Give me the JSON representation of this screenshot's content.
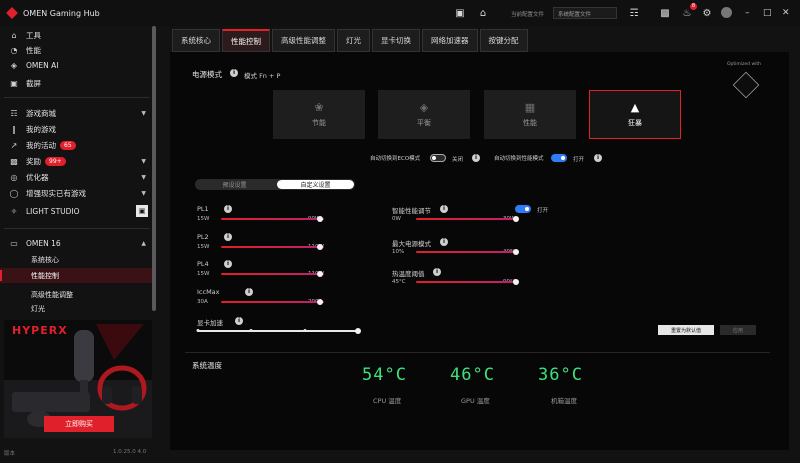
{
  "app": {
    "title": "OMEN Gaming Hub"
  },
  "titlebar": {
    "profile_label": "当前配置文件",
    "profile_value": "系统配置文件",
    "notification_count": "8",
    "icons": [
      "home-icon",
      "controller-icon",
      "gift-icon",
      "bell-icon",
      "gear-icon",
      "avatar"
    ]
  },
  "sidebar": {
    "top": [
      {
        "label": "工具",
        "icon": "home-icon"
      },
      {
        "label": "性能",
        "icon": "gauge-icon"
      },
      {
        "label": "OMEN AI",
        "icon": "diamond-icon"
      },
      {
        "label": "截屏",
        "icon": "camera-icon"
      }
    ],
    "middle": [
      {
        "label": "游戏商城",
        "icon": "gamepad-icon"
      },
      {
        "label": "我的游戏",
        "icon": "library-icon"
      },
      {
        "label": "我的活动",
        "icon": "chart-icon",
        "badge": "65"
      },
      {
        "label": "奖励",
        "icon": "gift-icon",
        "badge": "99+"
      },
      {
        "label": "优化器",
        "icon": "rocket-icon"
      },
      {
        "label": "增强现实已有游戏",
        "icon": "globe-icon"
      },
      {
        "label": "LIGHT STUDIO",
        "icon": "light-icon"
      }
    ],
    "device": {
      "label": "OMEN 16",
      "icon": "laptop-icon"
    },
    "device_items": [
      {
        "label": "系统核心"
      },
      {
        "label": "性能控制",
        "active": true
      },
      {
        "label": "高级性能调整"
      },
      {
        "label": "灯光"
      }
    ],
    "ad": {
      "brand": "HYPERX",
      "button": "立即购买"
    },
    "footer_left": "版本",
    "footer_right": "1.0.25.0 4.0"
  },
  "tabs": [
    "系统核心",
    "性能控制",
    "高级性能调整",
    "灯光",
    "显卡切换",
    "网络加速器",
    "按键分配"
  ],
  "power": {
    "title": "电源模式",
    "subtitle": "模式 Fn + P",
    "badge_text": "Optimized with",
    "modes": [
      {
        "label": "节能",
        "icon": "leaf-icon"
      },
      {
        "label": "平衡",
        "icon": "diamond-icon"
      },
      {
        "label": "性能",
        "icon": "bars-icon"
      },
      {
        "label": "狂暴",
        "icon": "flame-icon",
        "active": true
      }
    ]
  },
  "toggles": {
    "a_label": "自动切换到ECO模式",
    "a_state": "关闭",
    "b_label": "自动切换到性能模式",
    "b_state": "打开"
  },
  "segment": {
    "left": "预设设置",
    "right": "自定义设置",
    "active": "right"
  },
  "sliders_left": [
    {
      "label": "PL1",
      "min": "15W",
      "max": "90W",
      "fraction": 0.96
    },
    {
      "label": "PL2",
      "min": "15W",
      "max": "110W",
      "fraction": 0.96
    },
    {
      "label": "PL4",
      "min": "15W",
      "max": "110W",
      "fraction": 0.96
    },
    {
      "label": "IccMax",
      "min": "30A",
      "max": "200A",
      "fraction": 0.96
    }
  ],
  "sliders_right": [
    {
      "label": "智能性能调节",
      "min": "0W",
      "max": "30W",
      "fraction": 0.97,
      "toggle": "打开"
    },
    {
      "label": "最大电源模式",
      "min": "10%",
      "max": "40%",
      "fraction": 0.97
    },
    {
      "label": "热温度阈值",
      "min": "45°C",
      "max": "90°C",
      "fraction": 0.97
    }
  ],
  "gpu_slider": {
    "label": "显卡加速",
    "positions": 4,
    "selected": 3
  },
  "buttons": {
    "reset": "重置为默认值",
    "apply": "应用"
  },
  "temps": {
    "title": "系统温度",
    "items": [
      {
        "value": "54°C",
        "label": "CPU 温度"
      },
      {
        "value": "46°C",
        "label": "GPU 温度"
      },
      {
        "value": "36°C",
        "label": "机箱温度"
      }
    ]
  },
  "colors": {
    "accent": "#e0202a",
    "temp": "#3ee07a",
    "toggle_on": "#2f7df6"
  }
}
